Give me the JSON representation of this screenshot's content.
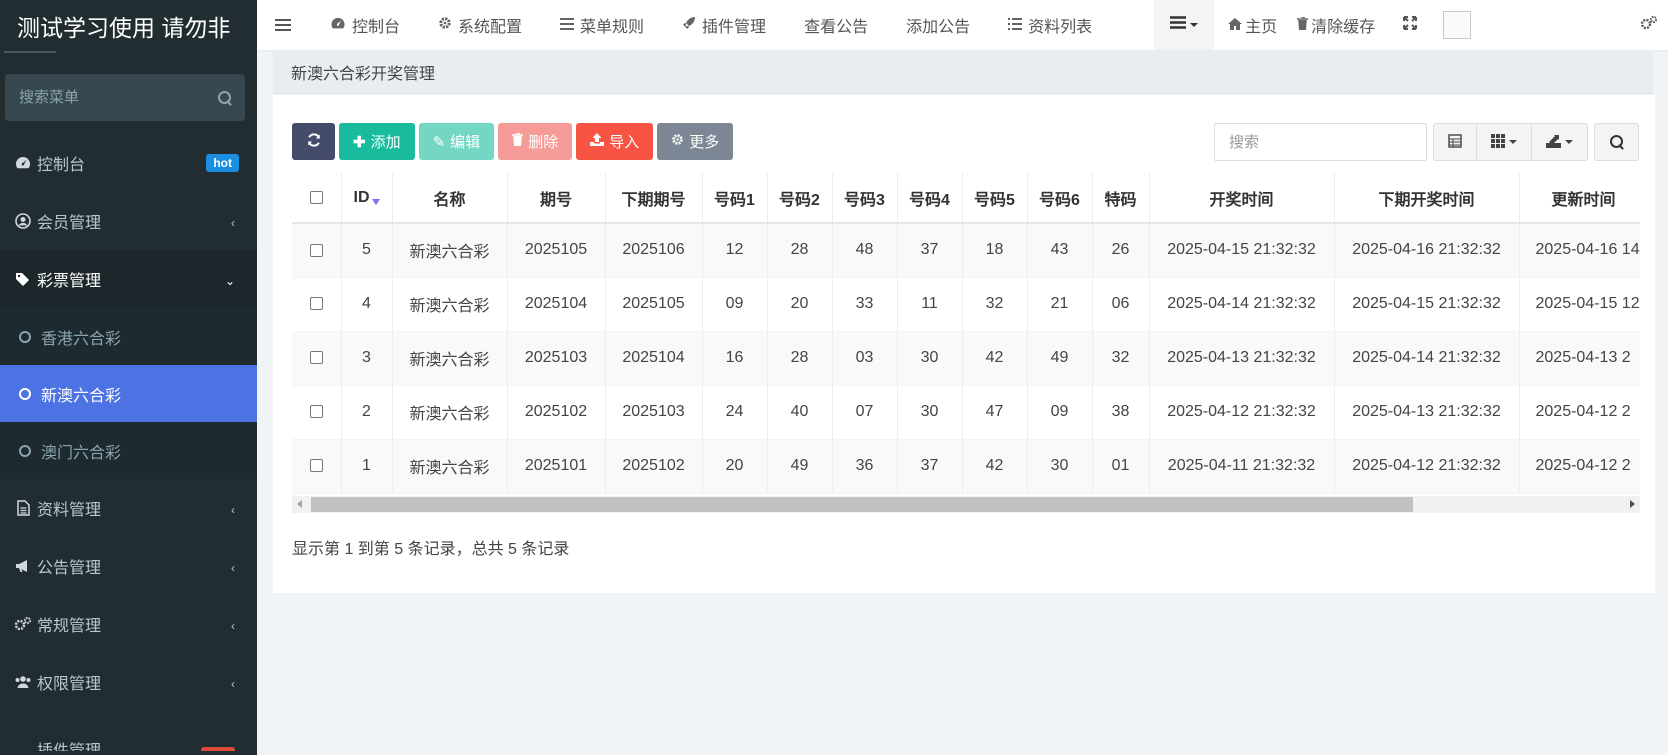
{
  "brand": {
    "title": "测试学习使用 请勿非"
  },
  "sidebar": {
    "search_placeholder": "搜索菜单",
    "items": [
      {
        "label": "控制台",
        "badge": "hot"
      },
      {
        "label": "会员管理"
      },
      {
        "label": "彩票管理"
      },
      {
        "label": "资料管理"
      },
      {
        "label": "公告管理"
      },
      {
        "label": "常规管理"
      },
      {
        "label": "权限管理"
      },
      {
        "label": "插件管理"
      }
    ],
    "submenu": [
      {
        "label": "香港六合彩"
      },
      {
        "label": "新澳六合彩"
      },
      {
        "label": "澳门六合彩"
      }
    ]
  },
  "navbar": {
    "links": [
      "控制台",
      "系统配置",
      "菜单规则",
      "插件管理",
      "查看公告",
      "添加公告",
      "资料列表"
    ],
    "home": "主页",
    "clear_cache": "清除缓存"
  },
  "page": {
    "title": "新澳六合彩开奖管理"
  },
  "toolbar": {
    "add": "添加",
    "edit": "编辑",
    "delete": "删除",
    "import": "导入",
    "more": "更多"
  },
  "table_search": {
    "placeholder": "搜索"
  },
  "table": {
    "columns": [
      "ID",
      "名称",
      "期号",
      "下期期号",
      "号码1",
      "号码2",
      "号码3",
      "号码4",
      "号码5",
      "号码6",
      "特码",
      "开奖时间",
      "下期开奖时间",
      "更新时间"
    ],
    "rows": [
      [
        "5",
        "新澳六合彩",
        "2025105",
        "2025106",
        "12",
        "28",
        "48",
        "37",
        "18",
        "43",
        "26",
        "2025-04-15 21:32:32",
        "2025-04-16 21:32:32",
        "2025-04-16 14"
      ],
      [
        "4",
        "新澳六合彩",
        "2025104",
        "2025105",
        "09",
        "20",
        "33",
        "11",
        "32",
        "21",
        "06",
        "2025-04-14 21:32:32",
        "2025-04-15 21:32:32",
        "2025-04-15 12"
      ],
      [
        "3",
        "新澳六合彩",
        "2025103",
        "2025104",
        "16",
        "28",
        "03",
        "30",
        "42",
        "49",
        "32",
        "2025-04-13 21:32:32",
        "2025-04-14 21:32:32",
        "2025-04-13 2"
      ],
      [
        "2",
        "新澳六合彩",
        "2025102",
        "2025103",
        "24",
        "40",
        "07",
        "30",
        "47",
        "09",
        "38",
        "2025-04-12 21:32:32",
        "2025-04-13 21:32:32",
        "2025-04-12 2"
      ],
      [
        "1",
        "新澳六合彩",
        "2025101",
        "2025102",
        "20",
        "49",
        "36",
        "37",
        "42",
        "30",
        "01",
        "2025-04-11 21:32:32",
        "2025-04-12 21:32:32",
        "2025-04-12 2"
      ]
    ]
  },
  "pagination": {
    "info": "显示第 1 到第 5 条记录，总共 5 条记录"
  },
  "colors": {
    "sidebar_bg": "#222d32",
    "selected": "#4c72e3",
    "success": "#18bc9c",
    "danger": "#f75444",
    "hot_badge": "#1a8ee0"
  }
}
